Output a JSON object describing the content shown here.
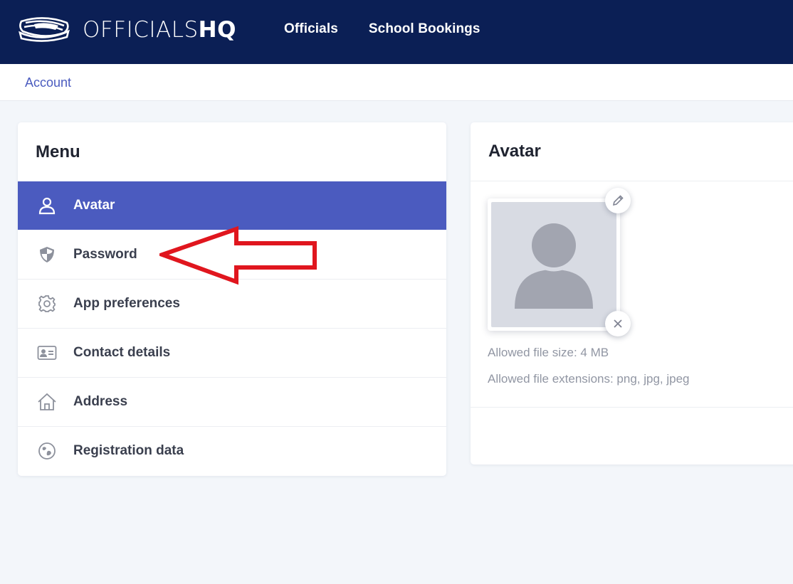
{
  "brand": {
    "name_light": "OFFICIALS",
    "name_bold": "HQ"
  },
  "nav": {
    "items": [
      {
        "label": "Officials"
      },
      {
        "label": "School Bookings"
      }
    ]
  },
  "breadcrumb": {
    "label": "Account"
  },
  "menu": {
    "title": "Menu",
    "items": [
      {
        "label": "Avatar",
        "icon": "user-icon",
        "active": true
      },
      {
        "label": "Password",
        "icon": "shield-icon"
      },
      {
        "label": "App preferences",
        "icon": "gear-icon"
      },
      {
        "label": "Contact details",
        "icon": "id-card-icon"
      },
      {
        "label": "Address",
        "icon": "home-icon"
      },
      {
        "label": "Registration data",
        "icon": "globe-icon"
      }
    ]
  },
  "avatar_panel": {
    "title": "Avatar",
    "size_hint": "Allowed file size: 4 MB",
    "ext_hint": "Allowed file extensions: png, jpg, jpeg"
  },
  "colors": {
    "topbar": "#0b1f55",
    "accent": "#4b5bbf",
    "arrow": "#e0161e"
  }
}
